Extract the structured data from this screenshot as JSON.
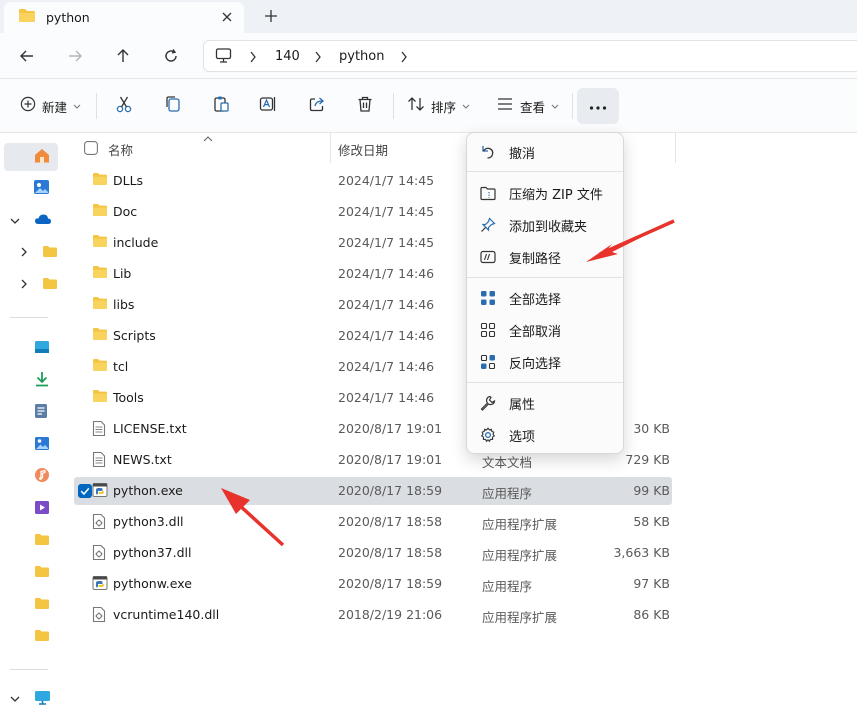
{
  "window": {
    "tab_title": "python"
  },
  "breadcrumb": [
    "140",
    "python"
  ],
  "toolbar": {
    "new_label": "新建",
    "sort_label": "排序",
    "view_label": "查看"
  },
  "columns": {
    "name": "名称",
    "date": "修改日期"
  },
  "files": [
    {
      "name": "DLLs",
      "date": "2024/1/7 14:45",
      "type": "",
      "size": "",
      "kind": "folder"
    },
    {
      "name": "Doc",
      "date": "2024/1/7 14:45",
      "type": "",
      "size": "",
      "kind": "folder"
    },
    {
      "name": "include",
      "date": "2024/1/7 14:45",
      "type": "",
      "size": "",
      "kind": "folder"
    },
    {
      "name": "Lib",
      "date": "2024/1/7 14:46",
      "type": "",
      "size": "",
      "kind": "folder"
    },
    {
      "name": "libs",
      "date": "2024/1/7 14:46",
      "type": "",
      "size": "",
      "kind": "folder"
    },
    {
      "name": "Scripts",
      "date": "2024/1/7 14:46",
      "type": "",
      "size": "",
      "kind": "folder"
    },
    {
      "name": "tcl",
      "date": "2024/1/7 14:46",
      "type": "",
      "size": "",
      "kind": "folder"
    },
    {
      "name": "Tools",
      "date": "2024/1/7 14:46",
      "type": "",
      "size": "",
      "kind": "folder"
    },
    {
      "name": "LICENSE.txt",
      "date": "2020/8/17 19:01",
      "type": "",
      "size": "30 KB",
      "kind": "text"
    },
    {
      "name": "NEWS.txt",
      "date": "2020/8/17 19:01",
      "type": "文本文档",
      "size": "729 KB",
      "kind": "text"
    },
    {
      "name": "python.exe",
      "date": "2020/8/17 18:59",
      "type": "应用程序",
      "size": "99 KB",
      "kind": "exe"
    },
    {
      "name": "python3.dll",
      "date": "2020/8/17 18:58",
      "type": "应用程序扩展",
      "size": "58 KB",
      "kind": "dll"
    },
    {
      "name": "python37.dll",
      "date": "2020/8/17 18:58",
      "type": "应用程序扩展",
      "size": "3,663 KB",
      "kind": "dll"
    },
    {
      "name": "pythonw.exe",
      "date": "2020/8/17 18:59",
      "type": "应用程序",
      "size": "97 KB",
      "kind": "exe"
    },
    {
      "name": "vcruntime140.dll",
      "date": "2018/2/19 21:06",
      "type": "应用程序扩展",
      "size": "86 KB",
      "kind": "dll"
    }
  ],
  "menu": {
    "items": [
      {
        "label": "撤消",
        "icon": "undo-icon"
      },
      {
        "label": "压缩为 ZIP 文件",
        "icon": "zip-icon"
      },
      {
        "label": "添加到收藏夹",
        "icon": "pin-icon"
      },
      {
        "label": "复制路径",
        "icon": "copy-path-icon"
      },
      {
        "label": "全部选择",
        "icon": "select-all-icon"
      },
      {
        "label": "全部取消",
        "icon": "select-none-icon"
      },
      {
        "label": "反向选择",
        "icon": "invert-selection-icon"
      },
      {
        "label": "属性",
        "icon": "properties-icon"
      },
      {
        "label": "选项",
        "icon": "options-icon"
      }
    ]
  },
  "colors": {
    "accent": "#0067c0",
    "folder": "#f4c542",
    "annotation_arrow": "#e8322c"
  }
}
